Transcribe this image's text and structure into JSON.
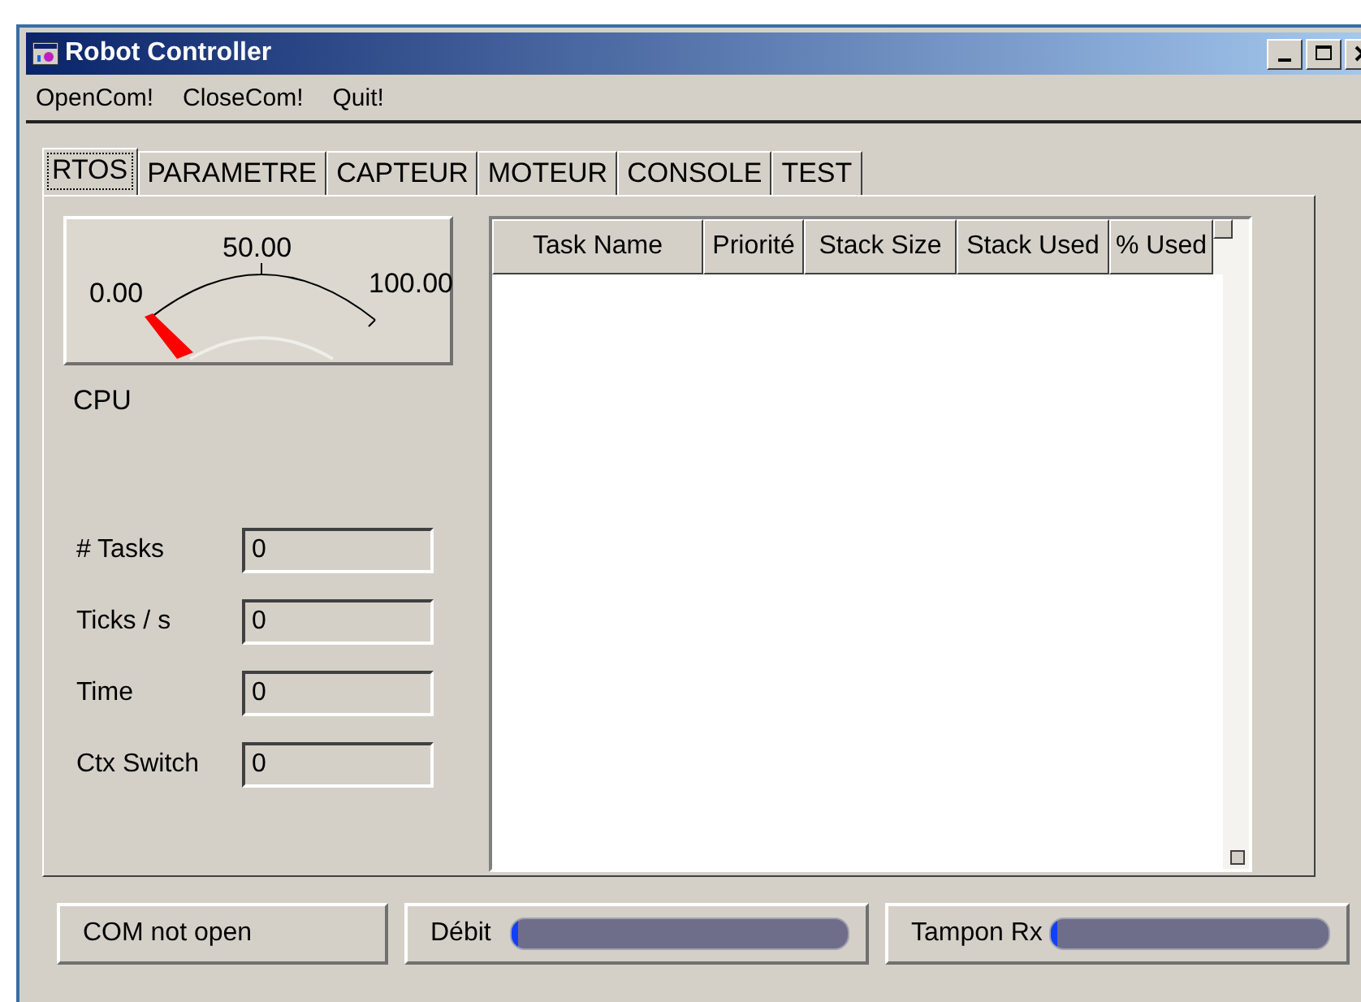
{
  "window": {
    "title": "Robot Controller"
  },
  "menu": [
    "OpenCom!",
    "CloseCom!",
    "Quit!"
  ],
  "tabs": [
    {
      "label": "RTOS",
      "selected": true
    },
    {
      "label": "PARAMETRE",
      "selected": false
    },
    {
      "label": "CAPTEUR",
      "selected": false
    },
    {
      "label": "MOTEUR",
      "selected": false
    },
    {
      "label": "CONSOLE",
      "selected": false
    },
    {
      "label": "TEST",
      "selected": false
    }
  ],
  "gauge": {
    "min": "0.00",
    "mid": "50.00",
    "max": "100.00",
    "label": "CPU"
  },
  "fields": [
    {
      "label": "# Tasks",
      "value": "0"
    },
    {
      "label": "Ticks / s",
      "value": "0"
    },
    {
      "label": "Time",
      "value": "0"
    },
    {
      "label": "Ctx Switch",
      "value": "0"
    }
  ],
  "table": {
    "columns": [
      "Task Name",
      "Priorité",
      "Stack Size",
      "Stack Used",
      "% Used"
    ]
  },
  "status_bar": {
    "status": "COM not open",
    "meters": [
      {
        "label": "Débit",
        "level": 0.02
      },
      {
        "label": "Tampon Rx",
        "level": 0.02
      }
    ]
  }
}
